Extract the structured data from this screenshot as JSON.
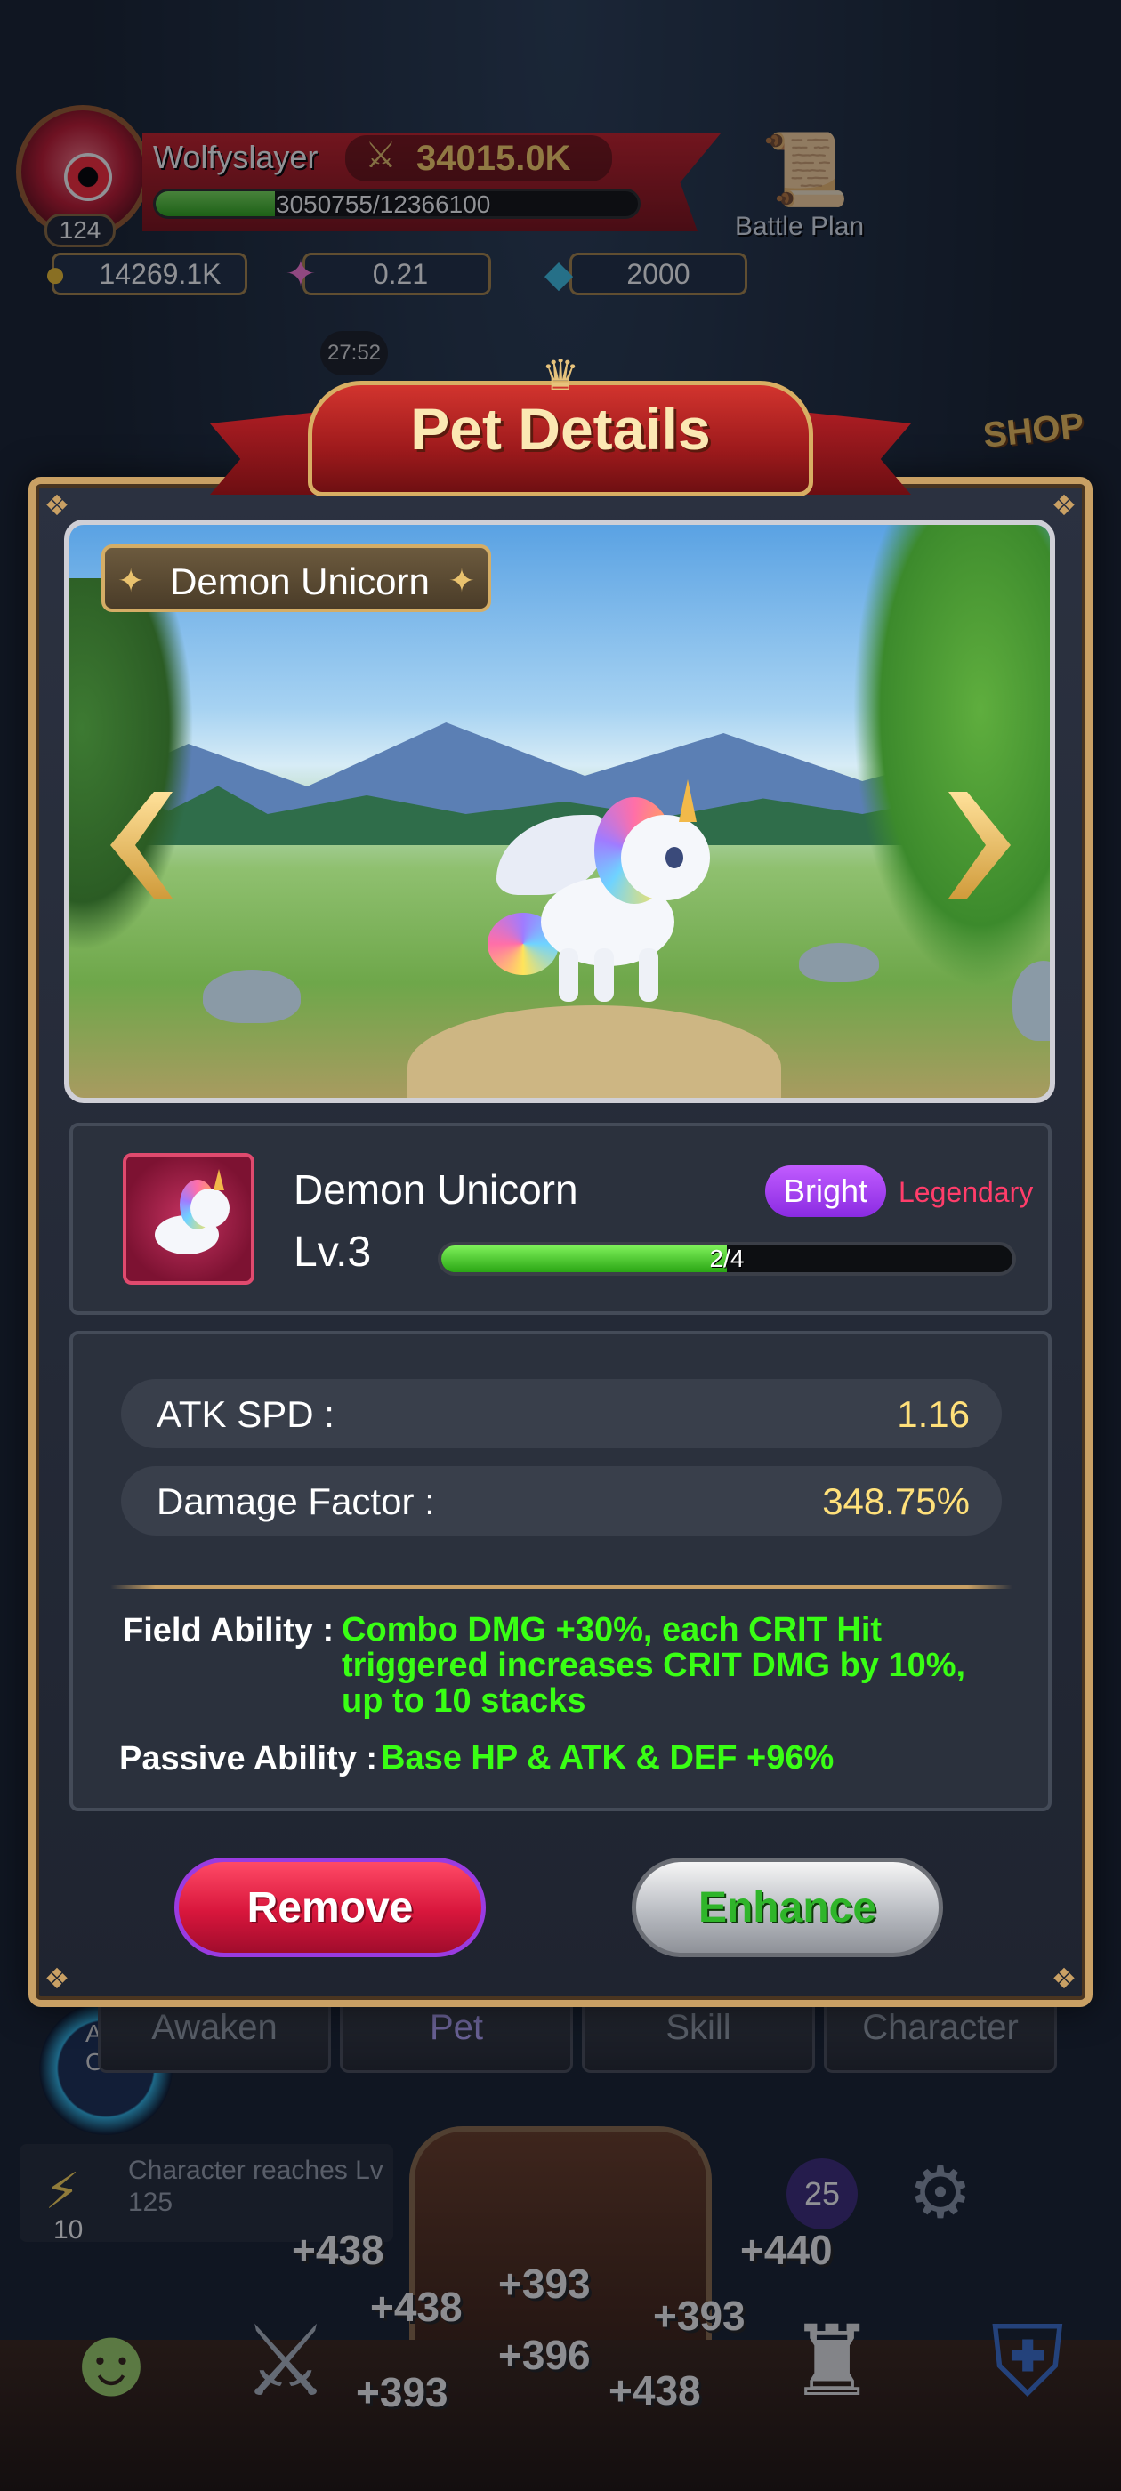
{
  "player": {
    "name": "Wolfyslayer",
    "level": "124",
    "power": "34015.0K",
    "exp_text": "3050755/12366100",
    "exp_progress": 0.247
  },
  "currencies": [
    {
      "icon": "coin-icon",
      "value": "14269.1K"
    },
    {
      "icon": "star-shard-icon",
      "value": "0.21"
    },
    {
      "icon": "gem-icon",
      "value": "2000"
    }
  ],
  "top_right": {
    "battle_plan_label": "Battle Plan",
    "shop_label": "SHOP"
  },
  "background": {
    "timer": "27:52",
    "tabs": [
      "Awaken",
      "Pet",
      "Skill",
      "Character"
    ],
    "auto_label": "AU\nON",
    "quest_text": "Character reaches Lv 125",
    "quest_count": "10",
    "badge_count": "25",
    "coin_pops": [
      "+438",
      "+440",
      "+438",
      "+393",
      "+393",
      "+396",
      "+393",
      "+438"
    ]
  },
  "modal": {
    "title": "Pet Details",
    "pet_name_plate": "Demon Unicorn",
    "pet_name": "Demon Unicorn",
    "pet_level": "Lv.3",
    "quality_badge": "Bright",
    "rarity": "Legendary",
    "level_progress_text": "2/4",
    "level_progress": 0.5,
    "stats": [
      {
        "label": "ATK SPD :",
        "value": "1.16"
      },
      {
        "label": "Damage Factor :",
        "value": "348.75%"
      }
    ],
    "field_ability_label": "Field Ability :",
    "field_ability_lines": [
      "Combo DMG +30%, each CRIT Hit",
      "triggered increases CRIT DMG by 10%,",
      "up to 10 stacks"
    ],
    "passive_ability_label": "Passive Ability :",
    "passive_ability_text": "Base HP & ATK & DEF +96%",
    "remove_label": "Remove",
    "enhance_label": "Enhance"
  },
  "colors": {
    "frame_gold": "#c9a064",
    "ability_green": "#39ff14",
    "stat_value_yellow": "#ffe07a",
    "legendary_red": "#ff3d6a",
    "bright_purple": "#b04cf5"
  }
}
